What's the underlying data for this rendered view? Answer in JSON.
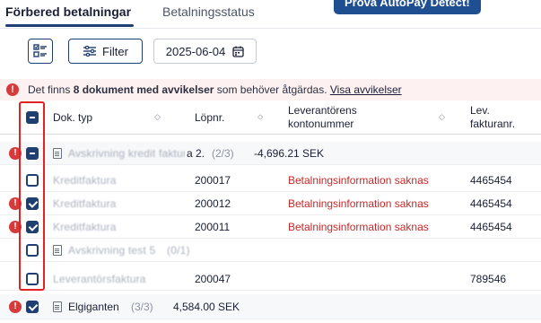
{
  "tabs": [
    {
      "label": "Förbered betalningar"
    },
    {
      "label": "Betalningsstatus"
    }
  ],
  "cta": {
    "label": "Prova AutoPay Detect!"
  },
  "toolbar": {
    "columns_icon": "columns-icon",
    "filter_label": "Filter",
    "filter_icon": "sliders-icon",
    "date_value": "2025-06-04",
    "calendar_icon": "calendar-icon"
  },
  "alert": {
    "prefix": "Det finns ",
    "bold": "8 dokument med avvikelser",
    "suffix": " som behöver åtgärdas. ",
    "link": "Visa avvikelser"
  },
  "table": {
    "headers": {
      "doc_type": "Dok. typ",
      "lopnr": "Löpnr.",
      "account_line1": "Leverantörens",
      "account_line2": "kontonummer",
      "invoice_line1": "Lev.",
      "invoice_line2": "fakturanr."
    },
    "rows": [
      {
        "name": "Avskrivning kredit faktura 2",
        "text_suffix": "a 2.",
        "count": "(2/3)",
        "amount": "-4,696.21 SEK"
      },
      {
        "doc_type": "Kreditfaktura",
        "lopnr": "200017",
        "status": "Betalningsinformation saknas",
        "invoice": "4465454"
      },
      {
        "doc_type": "Kreditfaktura",
        "lopnr": "200012",
        "status": "Betalningsinformation saknas",
        "invoice": "4465454"
      },
      {
        "doc_type": "Kreditfaktura",
        "lopnr": "200011",
        "status": "Betalningsinformation saknas",
        "invoice": "4465454"
      },
      {
        "name": "Avskrivning test 5",
        "count": "(0/1)"
      },
      {
        "doc_type": "Leverantörsfaktura",
        "lopnr": "200047",
        "invoice": "789546"
      },
      {
        "name": "Elgiganten",
        "count": "(3/3)",
        "amount": "4,584.00 SEK"
      }
    ]
  },
  "colors": {
    "primary": "#1f3f73",
    "error": "#d63a3a",
    "status_text": "#c62828",
    "alert_bg": "#fdf1f1"
  }
}
